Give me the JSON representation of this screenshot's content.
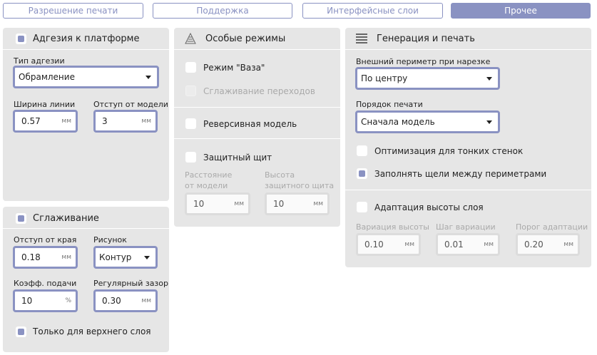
{
  "tabs": [
    "Разрешение печати",
    "Поддержка",
    "Интерфейсные слои",
    "Прочее"
  ],
  "adhesion": {
    "title": "Адгезия к платформе",
    "type_label": "Тип адгезии",
    "type_value": "Обрамление",
    "line_width_label": "Ширина линии",
    "line_width_value": "0.57",
    "offset_label": "Отступ от модели",
    "offset_value": "3",
    "unit": "мм"
  },
  "smoothing": {
    "title": "Сглаживание",
    "edge_offset_label": "Отступ от края",
    "edge_offset_value": "0.18",
    "pattern_label": "Рисунок",
    "pattern_value": "Контур",
    "feed_label": "Коэфф. подачи",
    "feed_value": "10",
    "feed_unit": "%",
    "gap_label": "Регулярный зазор",
    "gap_value": "0.30",
    "top_only_label": "Только для верхнего слоя",
    "unit": "мм"
  },
  "special": {
    "title": "Особые режимы",
    "vase_label": "Режим \"Ваза\"",
    "transition_label": "Сглаживание переходов",
    "reverse_label": "Реверсивная модель",
    "shield_label": "Защитный щит",
    "distance_label_1": "Расстояние",
    "distance_label_2": "от модели",
    "distance_value": "10",
    "height_label_1": "Высота",
    "height_label_2": "защитного щита",
    "height_value": "10",
    "unit": "мм"
  },
  "generation": {
    "title": "Генерация и печать",
    "perimeter_label": "Внешний периметр при нарезке",
    "perimeter_value": "По центру",
    "order_label": "Порядок печати",
    "order_value": "Сначала модель",
    "thin_walls_label": "Оптимизация для тонких стенок",
    "fill_gaps_label": "Заполнять щели между периметрами",
    "adaptive_label": "Адаптация высоты слоя",
    "variation_label": "Вариация высоты",
    "variation_value": "0.10",
    "step_label": "Шаг вариации",
    "step_value": "0.01",
    "threshold_label": "Порог адаптации",
    "threshold_value": "0.20",
    "unit": "мм"
  },
  "colors": {
    "accent": "#8a92c2",
    "panel": "#e6e6e6"
  }
}
